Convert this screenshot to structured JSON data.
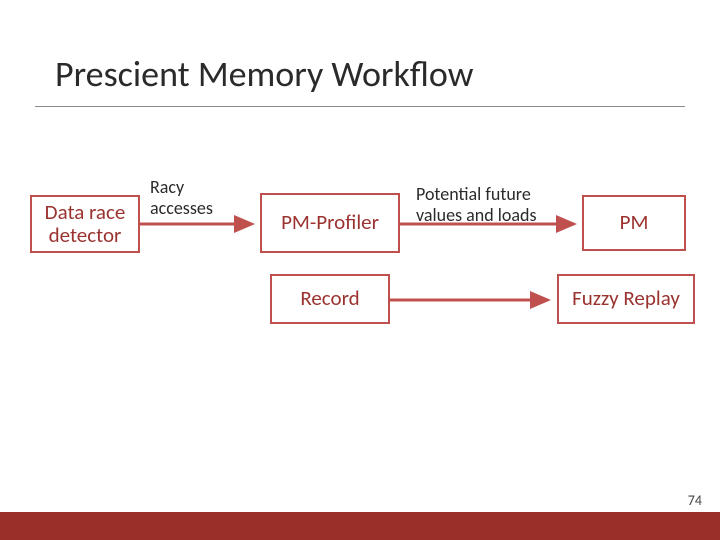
{
  "title": "Prescient Memory Workflow",
  "page_number": "74",
  "colors": {
    "accent": "#c0504d",
    "box_border": "#c0504d",
    "box_text": "#9a3330",
    "arrow": "#c0504d"
  },
  "boxes": {
    "data_race_detector": "Data race detector",
    "pm_profiler": "PM-Profiler",
    "record": "Record",
    "pm": "PM",
    "fuzzy_replay": "Fuzzy Replay"
  },
  "edges": {
    "racy_accesses": "Racy accesses",
    "potential": "Potential future values and loads"
  }
}
